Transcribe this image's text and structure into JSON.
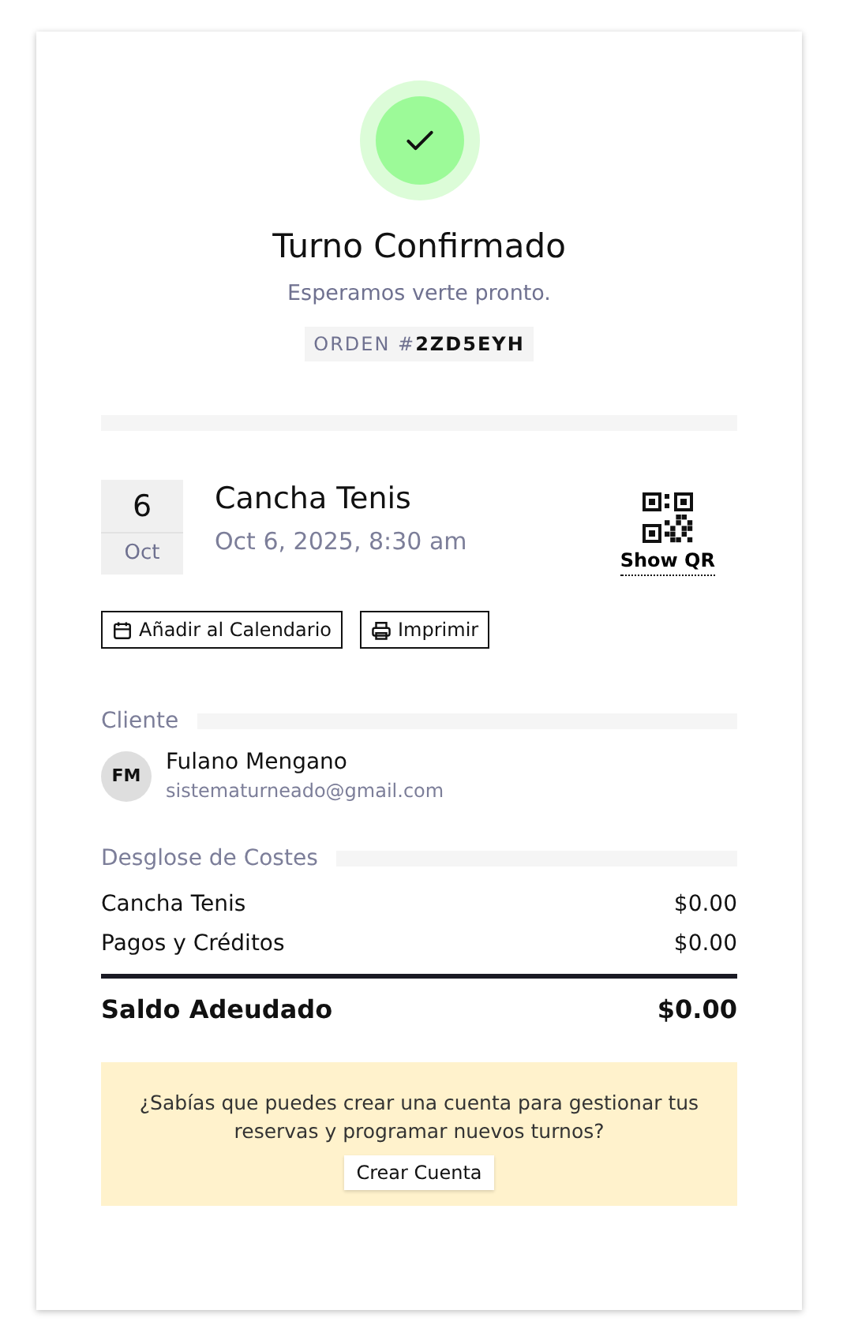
{
  "header": {
    "title": "Turno Confirmado",
    "subtitle": "Esperamos verte pronto.",
    "order": "ORDEN #**2ZD5EYH**"
  },
  "booking": {
    "day": "6",
    "month": "Oct",
    "service": "Cancha Tenis",
    "datetime": "Oct 6, 2025, 8:30 am",
    "qr_label": "Show QR"
  },
  "actions": [
    {
      "kind": "calendar",
      "label": "Añadir al Calendario"
    },
    {
      "kind": "print",
      "label": "Imprimir"
    }
  ],
  "client": {
    "heading": "Cliente",
    "initials": "FM",
    "name": "Fulano Mengano",
    "email": "sistematurneado@gmail.com"
  },
  "costs": {
    "heading": "Desglose de Costes",
    "rows": [
      {
        "label": "Cancha Tenis",
        "amount": "$0.00"
      },
      {
        "label": "Pagos y Créditos",
        "amount": "$0.00"
      }
    ],
    "total_label": "Saldo Adeudado",
    "total_amount": "$0.00"
  },
  "promo": {
    "text": "¿Sabías que puedes crear una cuenta para gestionar tus reservas y programar nuevos turnos?",
    "button": "Crear Cuenta"
  }
}
